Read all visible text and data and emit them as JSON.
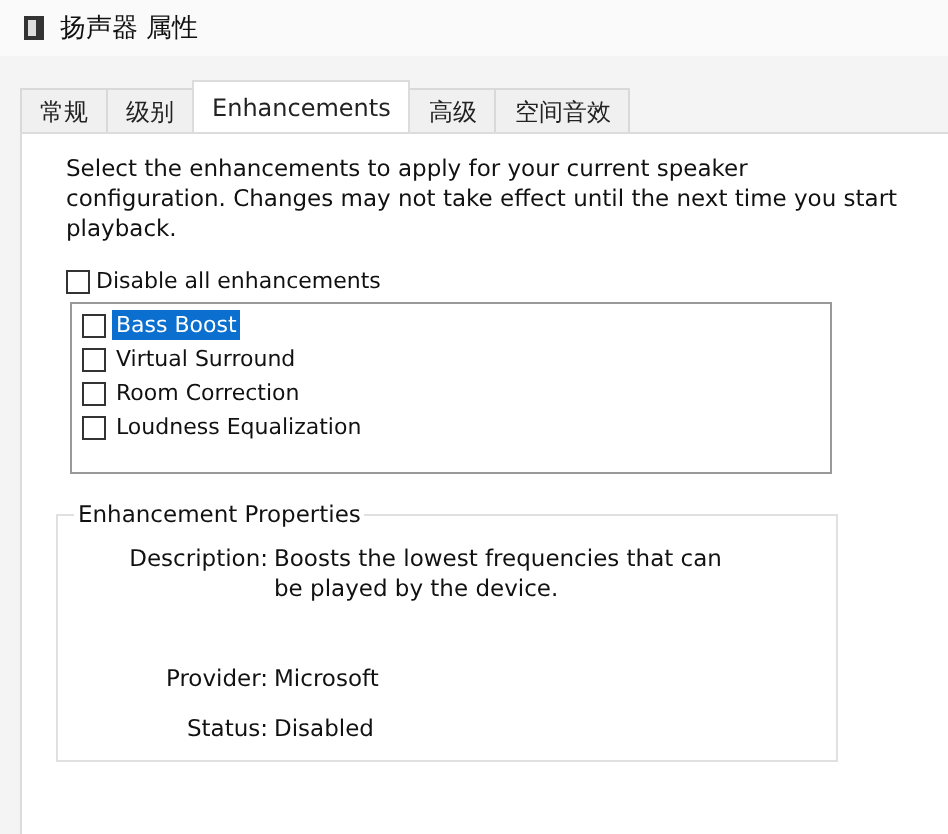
{
  "window": {
    "title": "扬声器 属性"
  },
  "tabs": [
    {
      "label": "常规",
      "selected": false
    },
    {
      "label": "级别",
      "selected": false
    },
    {
      "label": "Enhancements",
      "selected": true
    },
    {
      "label": "高级",
      "selected": false
    },
    {
      "label": "空间音效",
      "selected": false
    }
  ],
  "intro": "Select the enhancements to apply for your current speaker configuration. Changes may not take effect until the next time you start playback.",
  "disable_all": {
    "label": "Disable all enhancements",
    "checked": false
  },
  "enhancements": [
    {
      "label": "Bass Boost",
      "checked": false,
      "selected": true
    },
    {
      "label": "Virtual Surround",
      "checked": false,
      "selected": false
    },
    {
      "label": "Room Correction",
      "checked": false,
      "selected": false
    },
    {
      "label": "Loudness Equalization",
      "checked": false,
      "selected": false
    }
  ],
  "properties": {
    "title": "Enhancement Properties",
    "rows": [
      {
        "label": "Description:",
        "value": "Boosts the lowest frequencies that can be played by the device."
      },
      {
        "label": "Provider:",
        "value": "Microsoft"
      },
      {
        "label": "Status:",
        "value": "Disabled"
      }
    ]
  }
}
